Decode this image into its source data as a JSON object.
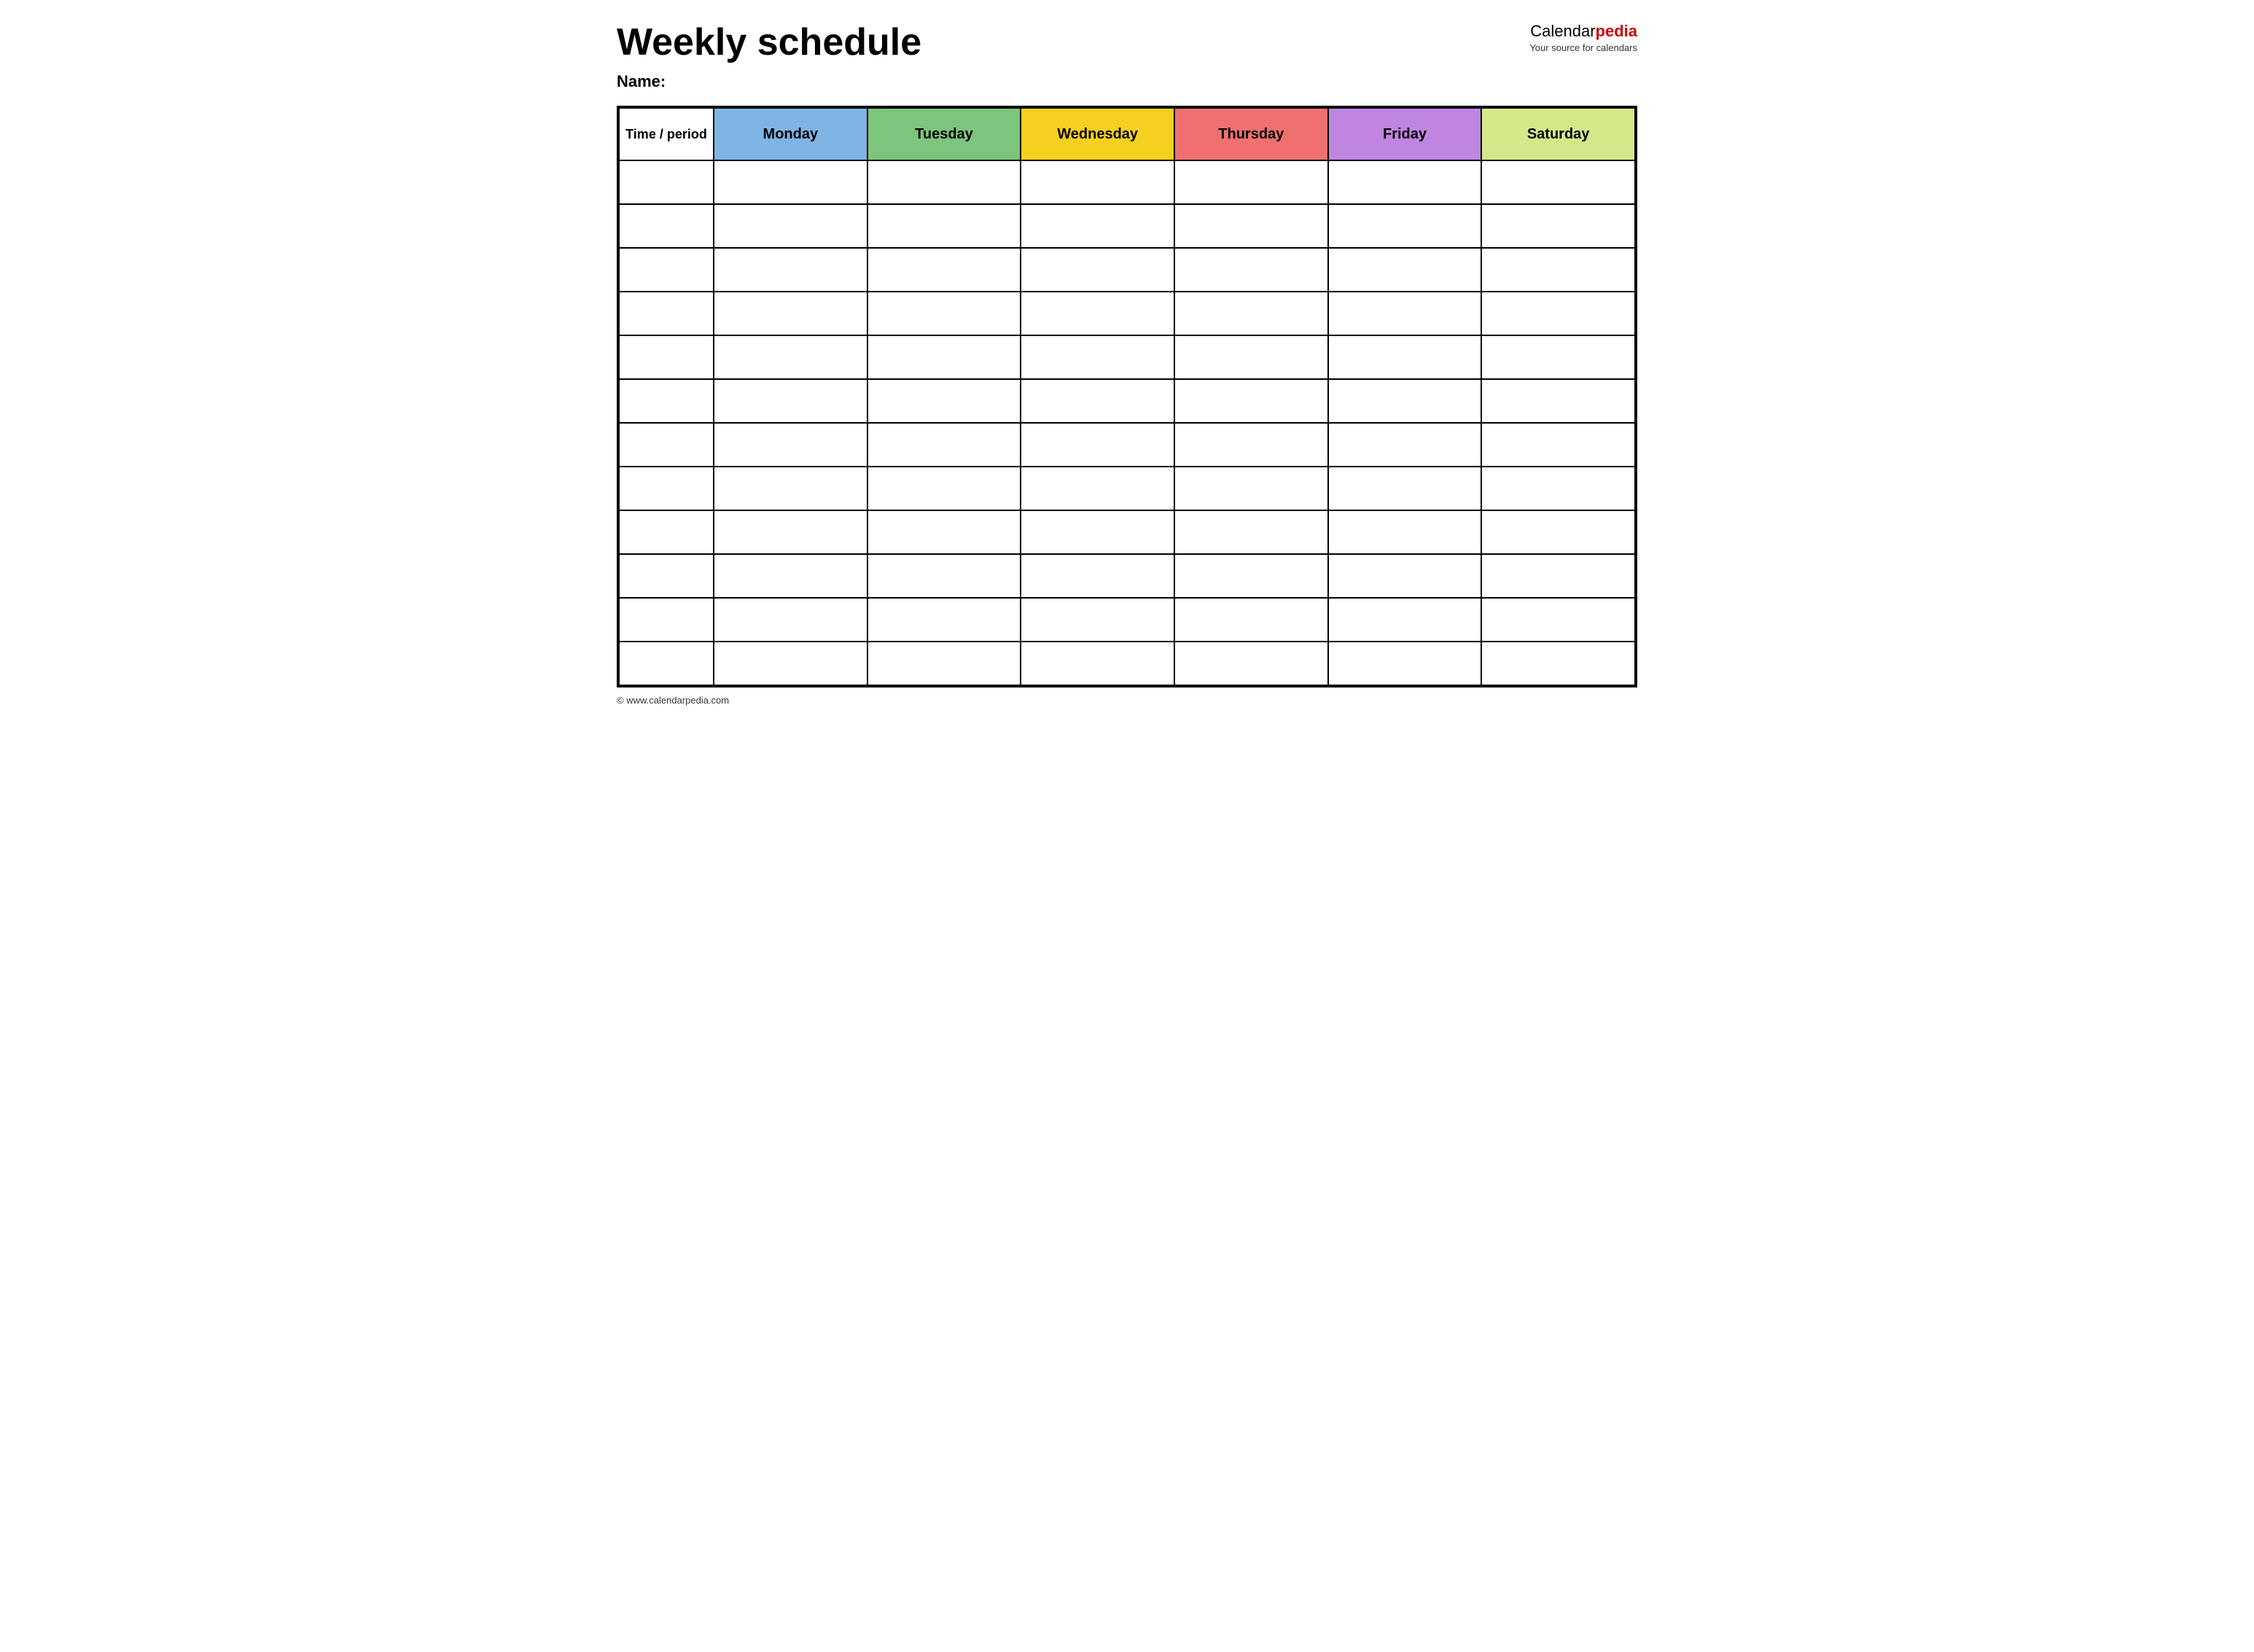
{
  "header": {
    "title": "Weekly schedule",
    "name_label": "Name:",
    "logo_text_calendar": "Calendar",
    "logo_text_pedia": "pedia",
    "logo_tagline": "Your source for calendars"
  },
  "table": {
    "columns": [
      {
        "key": "time",
        "label": "Time / period",
        "color": "#ffffff"
      },
      {
        "key": "monday",
        "label": "Monday",
        "color": "#80b3e6"
      },
      {
        "key": "tuesday",
        "label": "Tuesday",
        "color": "#7dc47d"
      },
      {
        "key": "wednesday",
        "label": "Wednesday",
        "color": "#f5d020"
      },
      {
        "key": "thursday",
        "label": "Thursday",
        "color": "#f07070"
      },
      {
        "key": "friday",
        "label": "Friday",
        "color": "#bf85e0"
      },
      {
        "key": "saturday",
        "label": "Saturday",
        "color": "#d4e88a"
      }
    ],
    "rows": [
      {
        "time": "",
        "monday": "",
        "tuesday": "",
        "wednesday": "",
        "thursday": "",
        "friday": "",
        "saturday": ""
      },
      {
        "time": "",
        "monday": "",
        "tuesday": "",
        "wednesday": "",
        "thursday": "",
        "friday": "",
        "saturday": ""
      },
      {
        "time": "",
        "monday": "",
        "tuesday": "",
        "wednesday": "",
        "thursday": "",
        "friday": "",
        "saturday": ""
      },
      {
        "time": "",
        "monday": "",
        "tuesday": "",
        "wednesday": "",
        "thursday": "",
        "friday": "",
        "saturday": ""
      },
      {
        "time": "",
        "monday": "",
        "tuesday": "",
        "wednesday": "",
        "thursday": "",
        "friday": "",
        "saturday": ""
      },
      {
        "time": "",
        "monday": "",
        "tuesday": "",
        "wednesday": "",
        "thursday": "",
        "friday": "",
        "saturday": ""
      },
      {
        "time": "",
        "monday": "",
        "tuesday": "",
        "wednesday": "",
        "thursday": "",
        "friday": "",
        "saturday": ""
      },
      {
        "time": "",
        "monday": "",
        "tuesday": "",
        "wednesday": "",
        "thursday": "",
        "friday": "",
        "saturday": ""
      },
      {
        "time": "",
        "monday": "",
        "tuesday": "",
        "wednesday": "",
        "thursday": "",
        "friday": "",
        "saturday": ""
      },
      {
        "time": "",
        "monday": "",
        "tuesday": "",
        "wednesday": "",
        "thursday": "",
        "friday": "",
        "saturday": ""
      },
      {
        "time": "",
        "monday": "",
        "tuesday": "",
        "wednesday": "",
        "thursday": "",
        "friday": "",
        "saturday": ""
      },
      {
        "time": "",
        "monday": "",
        "tuesday": "",
        "wednesday": "",
        "thursday": "",
        "friday": "",
        "saturday": ""
      }
    ]
  },
  "footer": {
    "url": "© www.calendarpedia.com"
  }
}
